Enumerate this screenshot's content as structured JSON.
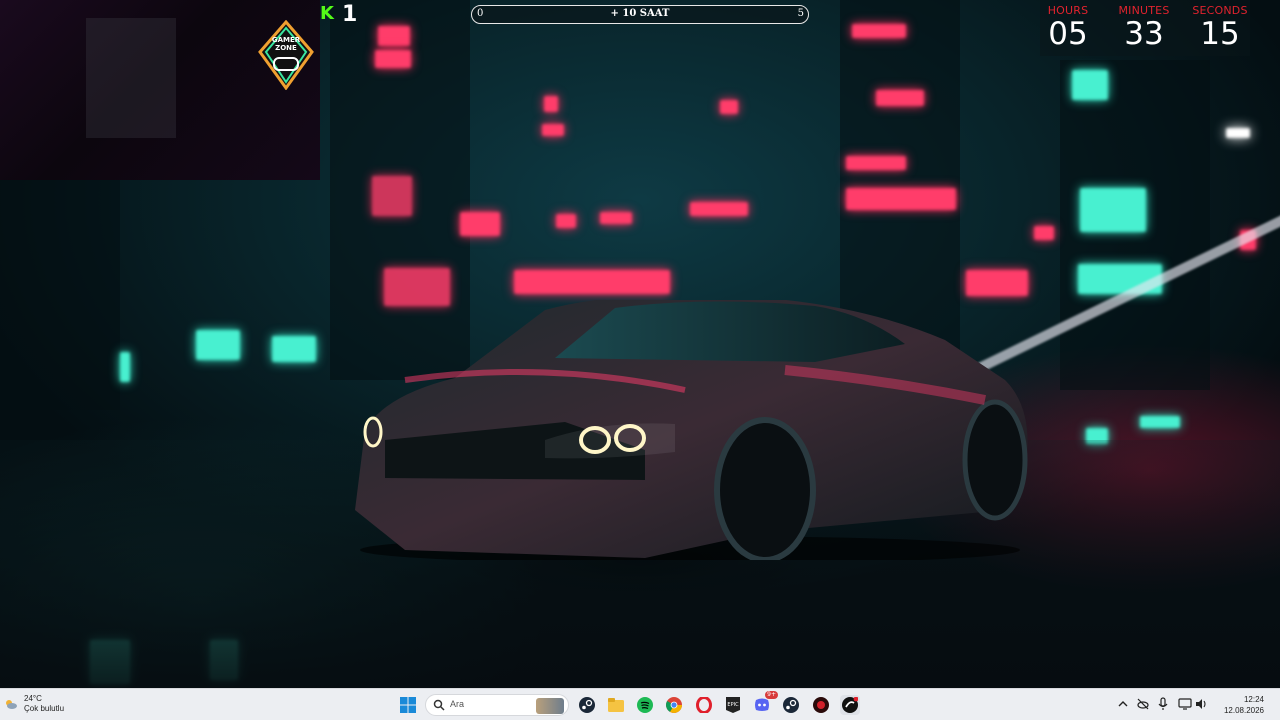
{
  "stream_overlay": {
    "webcam_logo_text": "GAMER ZONE",
    "kick_count": "1"
  },
  "progress": {
    "left_label": "0",
    "center_label": "+ 10 SAAT",
    "right_label": "5",
    "fill_fraction": 0
  },
  "countdown": {
    "hours_label": "HOURS",
    "minutes_label": "MINUTES",
    "seconds_label": "SECONDS",
    "hours": "05",
    "minutes": "33",
    "seconds": "15",
    "label_color": "#e0232e"
  },
  "taskbar": {
    "weather_temp": "24°C",
    "weather_desc": "Çok bulutlu",
    "search_placeholder": "Ara",
    "apps": [
      "windows-start",
      "search",
      "steam",
      "file-explorer",
      "spotify",
      "chrome",
      "opera",
      "epic-games",
      "discord",
      "steam-2",
      "media-player",
      "app-badge"
    ],
    "discord_badge": "9+",
    "time": "12:24",
    "date": "12.08.2026"
  }
}
